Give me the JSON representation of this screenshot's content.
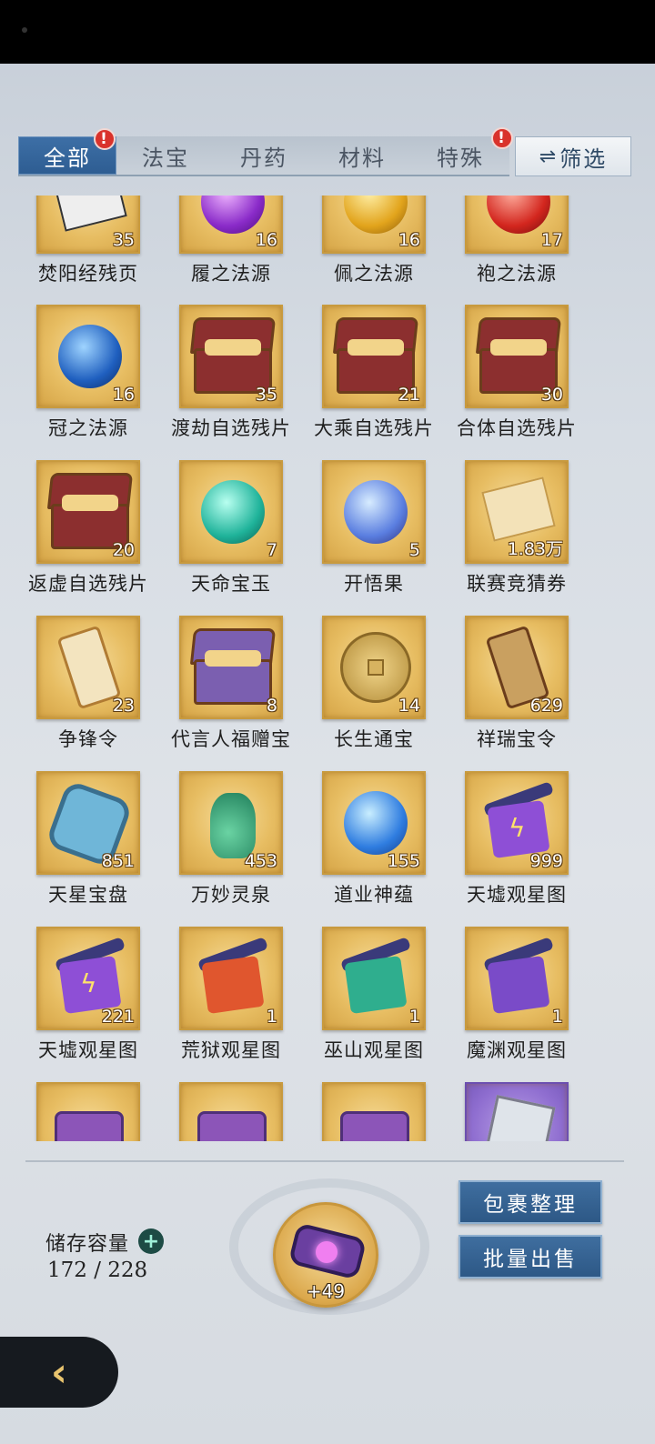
{
  "tabs": [
    {
      "label": "全部",
      "badge": "!",
      "active": true
    },
    {
      "label": "法宝",
      "badge": ""
    },
    {
      "label": "丹药",
      "badge": ""
    },
    {
      "label": "材料",
      "badge": ""
    },
    {
      "label": "特殊",
      "badge": "!"
    }
  ],
  "filter": {
    "icon": "⇌",
    "label": "筛选"
  },
  "items": [
    {
      "name": "焚阳经残页",
      "count": "35",
      "icon": "scroll-page-icon"
    },
    {
      "name": "履之法源",
      "count": "16",
      "icon": "purple-orb-icon"
    },
    {
      "name": "佩之法源",
      "count": "16",
      "icon": "gold-orb-icon"
    },
    {
      "name": "袍之法源",
      "count": "17",
      "icon": "red-orb-icon"
    },
    {
      "name": "冠之法源",
      "count": "16",
      "icon": "blue-orb-icon"
    },
    {
      "name": "渡劫自选残片",
      "count": "35",
      "icon": "chest-icon"
    },
    {
      "name": "大乘自选残片",
      "count": "21",
      "icon": "chest-icon"
    },
    {
      "name": "合体自选残片",
      "count": "30",
      "icon": "chest-icon"
    },
    {
      "name": "返虚自选残片",
      "count": "20",
      "icon": "chest-icon"
    },
    {
      "name": "天命宝玉",
      "count": "7",
      "icon": "jade-orb-icon"
    },
    {
      "name": "开悟果",
      "count": "5",
      "icon": "fruit-icon"
    },
    {
      "name": "联赛竞猜券",
      "count": "1.83万",
      "icon": "ticket-icon"
    },
    {
      "name": "争锋令",
      "count": "23",
      "icon": "token-icon"
    },
    {
      "name": "代言人福赠宝",
      "count": "8",
      "icon": "gift-box-icon"
    },
    {
      "name": "长生通宝",
      "count": "14",
      "icon": "coin-icon"
    },
    {
      "name": "祥瑞宝令",
      "count": "629",
      "icon": "plaque-icon"
    },
    {
      "name": "天星宝盘",
      "count": "851",
      "icon": "star-plate-icon"
    },
    {
      "name": "万妙灵泉",
      "count": "453",
      "icon": "vase-icon"
    },
    {
      "name": "道业神蕴",
      "count": "155",
      "icon": "spirit-orb-icon"
    },
    {
      "name": "天墟观星图",
      "count": "999",
      "icon": "purple-scroll-icon"
    },
    {
      "name": "天墟观星图",
      "count": "221",
      "icon": "purple-scroll-icon"
    },
    {
      "name": "荒狱观星图",
      "count": "1",
      "icon": "red-scroll-icon"
    },
    {
      "name": "巫山观星图",
      "count": "1",
      "icon": "teal-scroll-icon"
    },
    {
      "name": "魔渊观星图",
      "count": "1",
      "icon": "violet-scroll-icon"
    },
    {
      "name": "",
      "count": "",
      "icon": "bag-icon"
    },
    {
      "name": "",
      "count": "",
      "icon": "bag-icon"
    },
    {
      "name": "",
      "count": "",
      "icon": "bag-icon"
    },
    {
      "name": "",
      "count": "",
      "icon": "cloth-icon",
      "rarity": "purple"
    }
  ],
  "storage": {
    "label": "储存容量",
    "plus": "+",
    "value": "172 / 228"
  },
  "featured": {
    "count": "+49",
    "icon": "belt-icon"
  },
  "buttons": {
    "organize": "包裹整理",
    "batch_sell": "批量出售"
  },
  "back": {
    "icon": "back-chevron-icon",
    "glyph": "‹"
  }
}
